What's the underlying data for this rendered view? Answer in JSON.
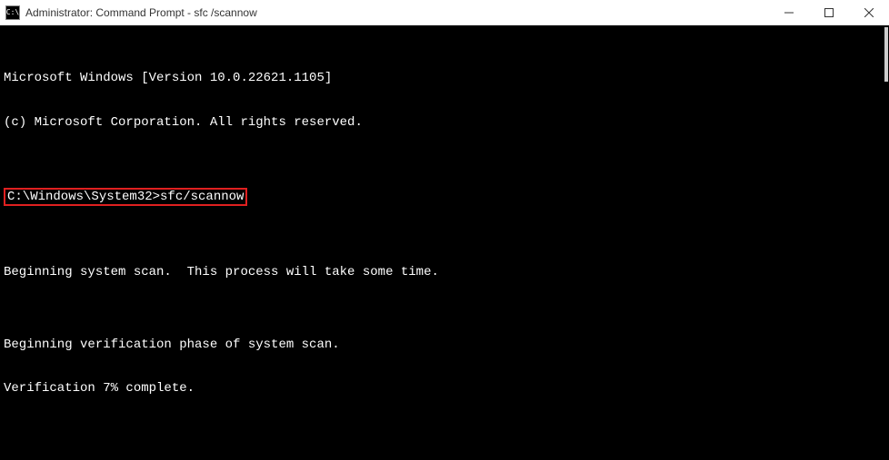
{
  "titlebar": {
    "icon_label": "C:\\",
    "title": "Administrator: Command Prompt - sfc /scannow"
  },
  "window_controls": {
    "minimize": "minimize",
    "maximize": "maximize",
    "close": "close"
  },
  "terminal": {
    "line1": "Microsoft Windows [Version 10.0.22621.1105]",
    "line2": "(c) Microsoft Corporation. All rights reserved.",
    "blank1": "",
    "prompt_line": "C:\\Windows\\System32>sfc/scannow",
    "blank2": "",
    "line3": "Beginning system scan.  This process will take some time.",
    "blank3": "",
    "line4": "Beginning verification phase of system scan.",
    "line5": "Verification 7% complete."
  }
}
